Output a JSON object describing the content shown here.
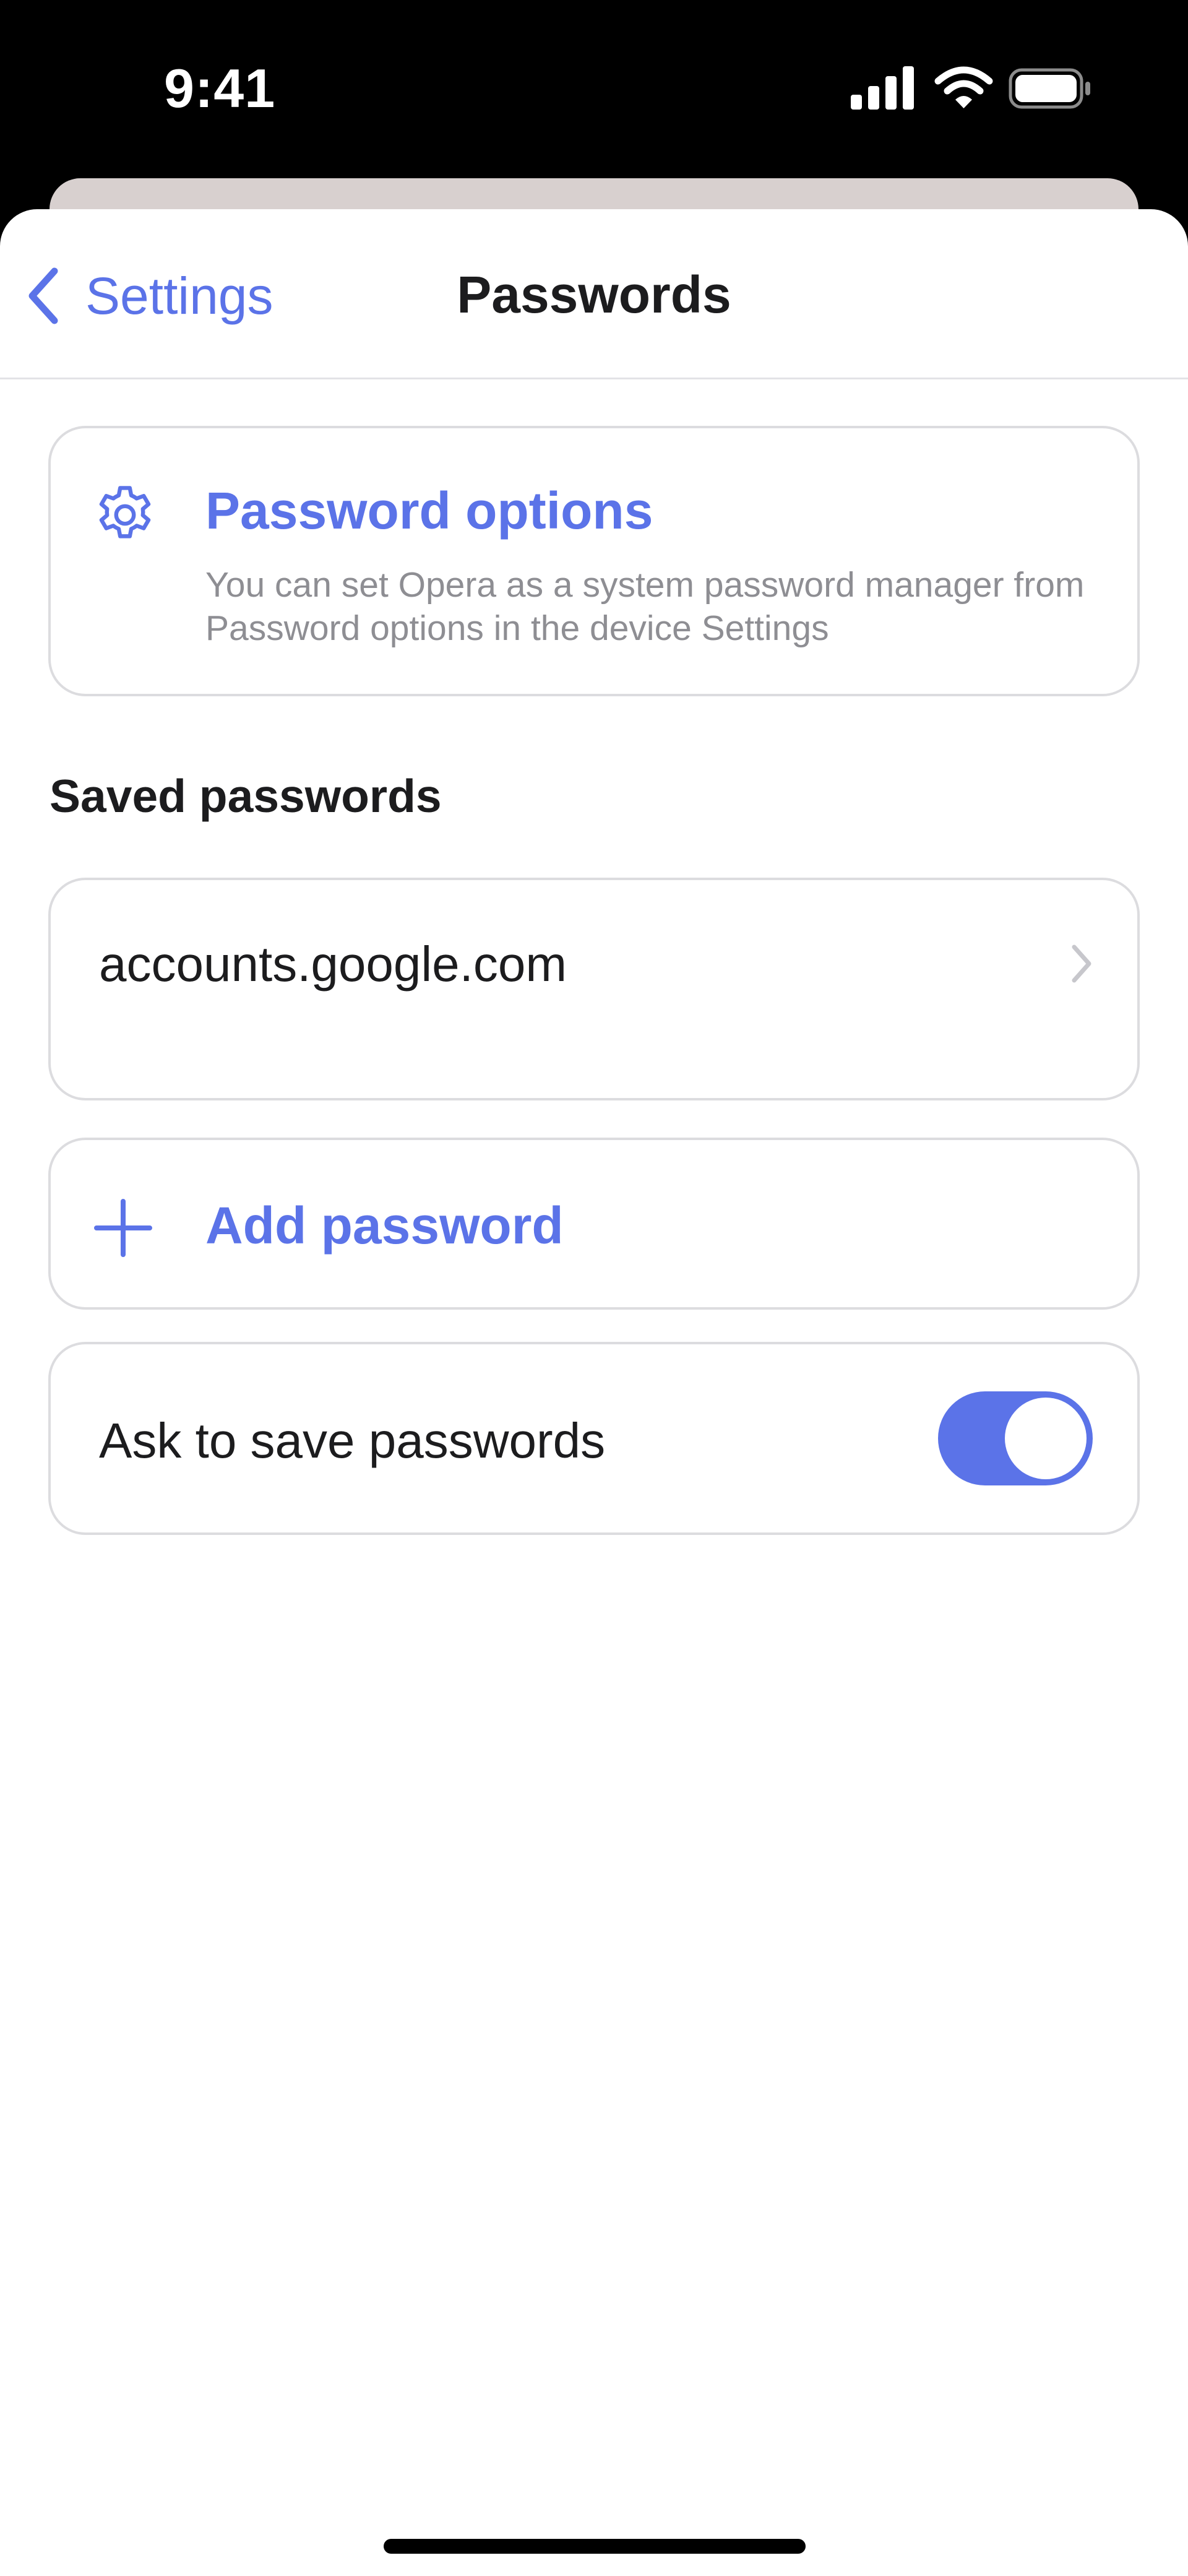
{
  "status_bar": {
    "time": "9:41",
    "icons": [
      "signal-icon",
      "wifi-icon",
      "battery-icon"
    ]
  },
  "nav": {
    "back_label": "Settings",
    "title": "Passwords"
  },
  "password_options": {
    "icon": "gear-icon",
    "title": "Password options",
    "description": "You can set Opera as a system password manager from Password options in the device Settings"
  },
  "saved_passwords": {
    "section_title": "Saved passwords",
    "items": [
      {
        "site": "accounts.google.com"
      }
    ]
  },
  "add_password": {
    "icon": "plus-icon",
    "label": "Add password"
  },
  "ask_to_save": {
    "label": "Ask to save passwords",
    "enabled": true
  },
  "colors": {
    "accent": "#5b73e8",
    "text_primary": "#1c1c1e",
    "text_secondary": "#8e8e93",
    "card_border": "#dcdcdf"
  }
}
